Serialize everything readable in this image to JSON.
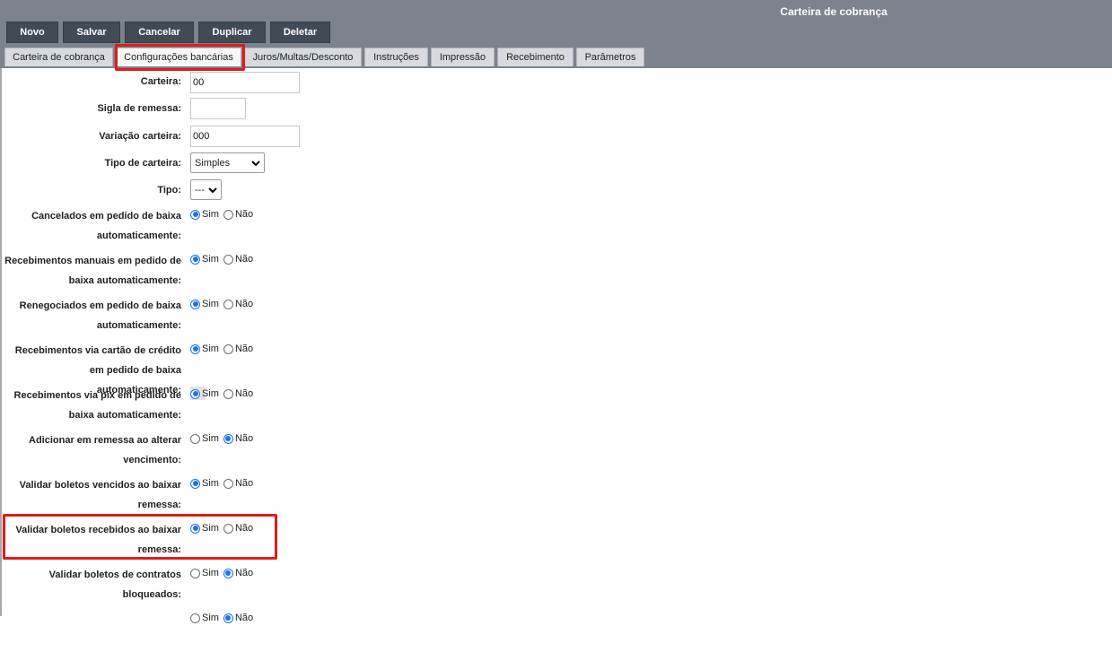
{
  "window": {
    "title": "Carteira de cobrança"
  },
  "toolbar": [
    {
      "label": "Novo"
    },
    {
      "label": "Salvar"
    },
    {
      "label": "Cancelar"
    },
    {
      "label": "Duplicar"
    },
    {
      "label": "Deletar"
    }
  ],
  "tabs": [
    {
      "label": "Carteira de cobrança",
      "active": false
    },
    {
      "label": "Configurações bancárias",
      "active": true
    },
    {
      "label": "Juros/Multas/Desconto",
      "active": false
    },
    {
      "label": "Instruções",
      "active": false
    },
    {
      "label": "Impressão",
      "active": false
    },
    {
      "label": "Recebimento",
      "active": false
    },
    {
      "label": "Parâmetros",
      "active": false
    }
  ],
  "form": {
    "carteira": {
      "label": "Carteira:",
      "value": "00"
    },
    "sigla": {
      "label": "Sigla de remessa:",
      "value": ""
    },
    "variacao": {
      "label": "Variação carteira:",
      "value": "000"
    },
    "tipo_carteira": {
      "label": "Tipo de carteira:",
      "value": "Simples"
    },
    "tipo": {
      "label": "Tipo:",
      "value": "---"
    },
    "radio_sim": "Sim",
    "radio_nao": "Não",
    "options": [
      {
        "line1": "Cancelados em pedido de baixa",
        "line2": "automaticamente:",
        "selected": "Sim"
      },
      {
        "line1": "Recebimentos manuais em pedido de",
        "line2": "baixa automaticamente:",
        "selected": "Sim"
      },
      {
        "line1": "Renegociados em pedido de baixa",
        "line2": "automaticamente:",
        "selected": "Sim"
      },
      {
        "line1": "Recebimentos via cartão de crédito",
        "line2": "em pedido de baixa automaticamente:",
        "selected": "Sim"
      },
      {
        "line1": "Recebimentos via pix em pedido de",
        "line2": "baixa automaticamente:",
        "selected": "Sim"
      },
      {
        "line1": "Adicionar em remessa ao alterar",
        "line2": "vencimento:",
        "selected": "Não"
      },
      {
        "line1": "Validar boletos vencidos ao baixar",
        "line2": "remessa:",
        "selected": "Sim"
      },
      {
        "line1": "Validar boletos recebidos ao baixar",
        "line2": "remessa:",
        "selected": "Sim"
      },
      {
        "line1": "Validar boletos de contratos",
        "line2": "bloqueados:",
        "selected": "Não"
      },
      {
        "line1": "",
        "line2": "",
        "selected": "Não"
      }
    ]
  },
  "colors": {
    "topbar": "#7c838c",
    "toolbar_button": "#414b56",
    "highlight": "#e11b1b",
    "radio_accent": "#1a73e8"
  }
}
